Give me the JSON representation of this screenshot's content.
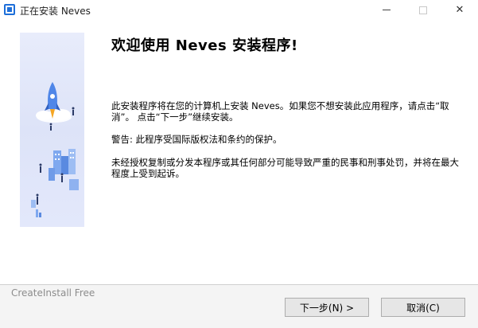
{
  "window": {
    "title": "正在安装 Neves",
    "minimize_icon": "minimize-icon",
    "maximize_icon": "maximize-icon",
    "close_icon": "close-icon",
    "close_glyph": "✕"
  },
  "content": {
    "heading": "欢迎使用 Neves 安装程序!",
    "paragraph1": "此安装程序将在您的计算机上安装 Neves。如果您不想安装此应用程序，请点击“取消”。 点击“下一步”继续安装。",
    "paragraph2": "警告: 此程序受国际版权法和条约的保护。",
    "paragraph3": "未经授权复制或分发本程序或其任何部分可能导致严重的民事和刑事处罚，并将在最大程度上受到起诉。"
  },
  "footer": {
    "brand": "CreateInstall Free",
    "next_label": "下一步(N) >",
    "cancel_label": "取消(C)"
  },
  "colors": {
    "accent": "#1e6fd9",
    "side_panel": "#e3e8fb"
  }
}
